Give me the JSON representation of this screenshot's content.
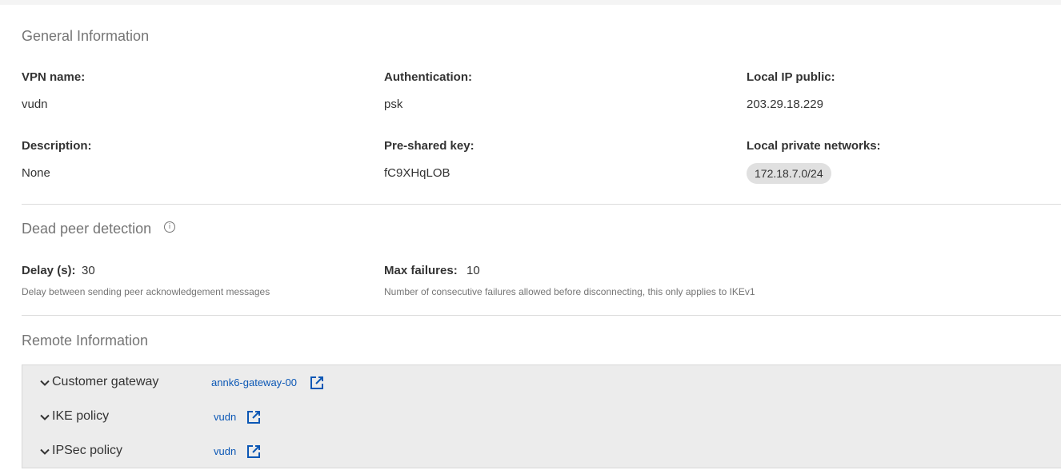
{
  "general": {
    "title": "General Information",
    "vpn_name_label": "VPN name:",
    "vpn_name_value": "vudn",
    "auth_label": "Authentication:",
    "auth_value": "psk",
    "local_ip_label": "Local IP public:",
    "local_ip_value": "203.29.18.229",
    "description_label": "Description:",
    "description_value": "None",
    "psk_label": "Pre-shared key:",
    "psk_value": "fC9XHqLOB",
    "local_networks_label": "Local private networks:",
    "local_networks": [
      "172.18.7.0/24"
    ]
  },
  "dpd": {
    "title": "Dead peer detection",
    "info_icon": "info-circle-icon",
    "delay_label": "Delay (s):",
    "delay_value": "30",
    "delay_hint": "Delay between sending peer acknowledgement messages",
    "max_failures_label": "Max failures:",
    "max_failures_value": "10",
    "max_failures_hint": "Number of consecutive failures allowed before disconnecting, this only applies to IKEv1"
  },
  "remote": {
    "title": "Remote Information",
    "rows": [
      {
        "label": "Customer gateway",
        "link": "annk6-gateway-00",
        "icon": "external-link-icon"
      },
      {
        "label": "IKE policy",
        "link": "vudn",
        "icon": "external-link-icon"
      },
      {
        "label": "IPSec policy",
        "link": "vudn",
        "icon": "external-link-icon"
      }
    ]
  },
  "colors": {
    "link": "#0b57b5",
    "heading": "#757575",
    "chip_bg": "#e0e0e0",
    "remote_bg": "#ececec"
  }
}
